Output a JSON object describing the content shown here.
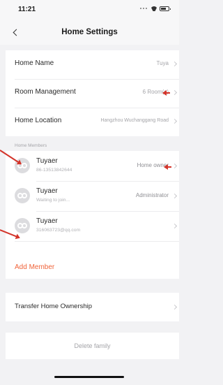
{
  "status": {
    "time": "11:21"
  },
  "nav": {
    "title": "Home Settings"
  },
  "settings": [
    {
      "label": "Home Name",
      "value": "Tuya"
    },
    {
      "label": "Room Management",
      "value": "6 Room(s)"
    },
    {
      "label": "Home Location",
      "value": "Hangzhou Wuchanggang Road"
    }
  ],
  "members_section": {
    "title": "Home Members",
    "members": [
      {
        "name": "Tuyaer",
        "detail": "86-13513842644",
        "role": "Home owner"
      },
      {
        "name": "Tuyaer",
        "detail": "Waiting to join...",
        "role": "Administrator"
      },
      {
        "name": "Tuyaer",
        "detail": "316063723@qq.com",
        "role": ""
      }
    ],
    "add_label": "Add Member"
  },
  "transfer": {
    "label": "Transfer Home Ownership"
  },
  "delete": {
    "label": "Delete family"
  },
  "colors": {
    "accent": "#f0643a",
    "annotation_arrow": "#d3342a"
  }
}
